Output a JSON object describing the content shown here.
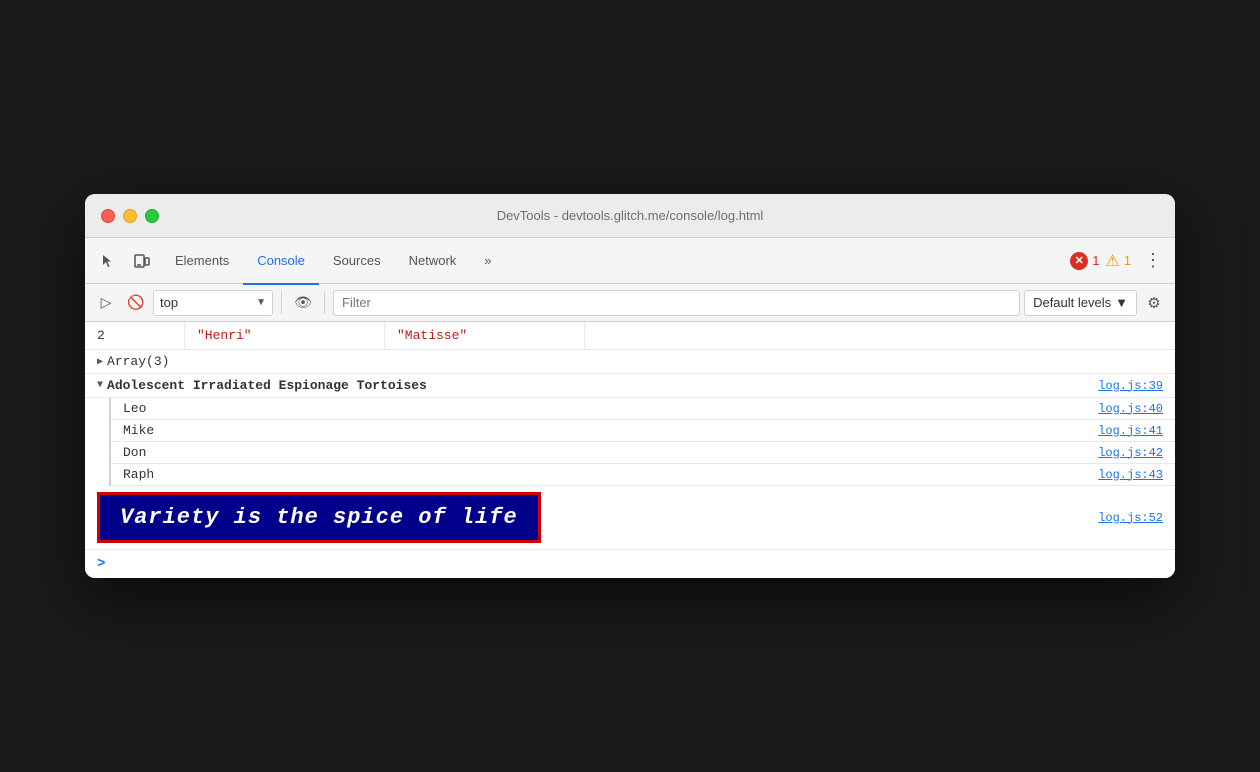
{
  "window": {
    "title": "DevTools - devtools.glitch.me/console/log.html"
  },
  "tabs": [
    {
      "label": "Elements",
      "active": false
    },
    {
      "label": "Console",
      "active": true
    },
    {
      "label": "Sources",
      "active": false
    },
    {
      "label": "Network",
      "active": false
    },
    {
      "label": "»",
      "active": false
    }
  ],
  "errors": {
    "count": "1",
    "warnings": "1"
  },
  "console_toolbar": {
    "context": "top",
    "filter_placeholder": "Filter",
    "levels_label": "Default levels"
  },
  "table": {
    "row_number": "2",
    "col1": "\"Henri\"",
    "col2": "\"Matisse\""
  },
  "array_label": "▶ Array(3)",
  "group": {
    "triangle": "▼",
    "name": "Adolescent Irradiated Espionage Tortoises",
    "link": "log.js:39",
    "items": [
      {
        "name": "Leo",
        "link": "log.js:40"
      },
      {
        "name": "Mike",
        "link": "log.js:41"
      },
      {
        "name": "Don",
        "link": "log.js:42"
      },
      {
        "name": "Raph",
        "link": "log.js:43"
      }
    ]
  },
  "styled_log": {
    "message": "Variety is the spice of life",
    "link": "log.js:52"
  },
  "prompt": {
    "symbol": ">"
  }
}
